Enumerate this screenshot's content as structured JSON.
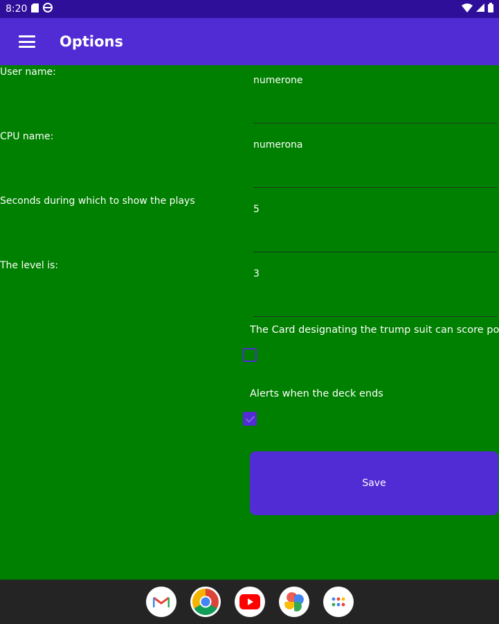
{
  "status_bar": {
    "time": "8:20",
    "icons": [
      "sim-card-icon",
      "vpn-globe-icon",
      "wifi-icon",
      "signal-icon",
      "battery-icon"
    ]
  },
  "app_bar": {
    "title": "Options",
    "menu_icon": "hamburger-menu-icon"
  },
  "form": {
    "fields": [
      {
        "label": "User name:",
        "value": "numerone"
      },
      {
        "label": "CPU name:",
        "value": "numerona"
      },
      {
        "label": "Seconds during which to show the plays",
        "value": "5"
      },
      {
        "label": "The level is:",
        "value": "3"
      }
    ],
    "checkboxes": [
      {
        "label": "The Card designating the trump suit can score points",
        "checked": false
      },
      {
        "label": "Alerts when the deck ends",
        "checked": true
      }
    ],
    "save_label": "Save"
  },
  "dock": {
    "apps": [
      "gmail-icon",
      "chrome-icon",
      "youtube-icon",
      "photos-icon",
      "app-drawer-icon"
    ]
  },
  "colors": {
    "background": "#008000",
    "accent": "#512bd4",
    "status_bar": "#2e0f9a",
    "nav_bar": "#242424"
  }
}
